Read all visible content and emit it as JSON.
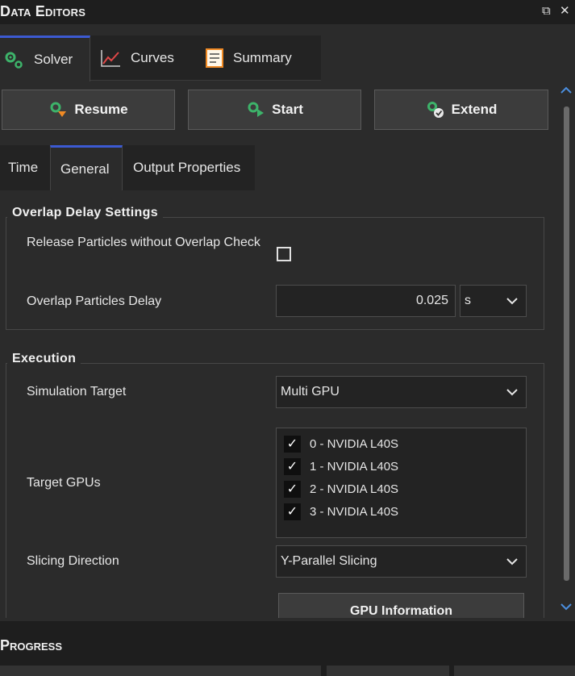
{
  "panel": {
    "title": "Data Editors",
    "float_glyph": "⧉",
    "close_glyph": "✕"
  },
  "top_tabs": [
    {
      "label": "Solver",
      "icon": "gears-icon",
      "active": true
    },
    {
      "label": "Curves",
      "icon": "line-chart-icon",
      "active": false
    },
    {
      "label": "Summary",
      "icon": "summary-document-icon",
      "active": false
    }
  ],
  "actions": {
    "resume": "Resume",
    "start": "Start",
    "extend": "Extend"
  },
  "sub_tabs": [
    {
      "label": "Time",
      "active": false
    },
    {
      "label": "General",
      "active": true
    },
    {
      "label": "Output Properties",
      "active": false
    }
  ],
  "overlap": {
    "title": "Overlap Delay Settings",
    "release_label": "Release Particles without Overlap Check",
    "release_checked": false,
    "delay_label": "Overlap Particles Delay",
    "delay_value": "0.025",
    "delay_unit": "s"
  },
  "execution": {
    "title": "Execution",
    "target_label": "Simulation Target",
    "target_value": "Multi GPU",
    "gpus_label": "Target GPUs",
    "gpus": [
      {
        "label": "0 - NVIDIA L40S",
        "checked": true
      },
      {
        "label": "1 - NVIDIA L40S",
        "checked": true
      },
      {
        "label": "2 - NVIDIA L40S",
        "checked": true
      },
      {
        "label": "3 - NVIDIA L40S",
        "checked": true
      }
    ],
    "slicing_label": "Slicing Direction",
    "slicing_value": "Y-Parallel Slicing",
    "gpu_info_button": "GPU Information"
  },
  "progress": {
    "title": "Progress"
  },
  "colors": {
    "accent": "#3c5ad2",
    "panel_bg": "#2b2b2b",
    "header_bg": "#1e1e1e",
    "icon_green": "#3db36a",
    "icon_orange": "#f08a24",
    "curve_red": "#e04848"
  }
}
